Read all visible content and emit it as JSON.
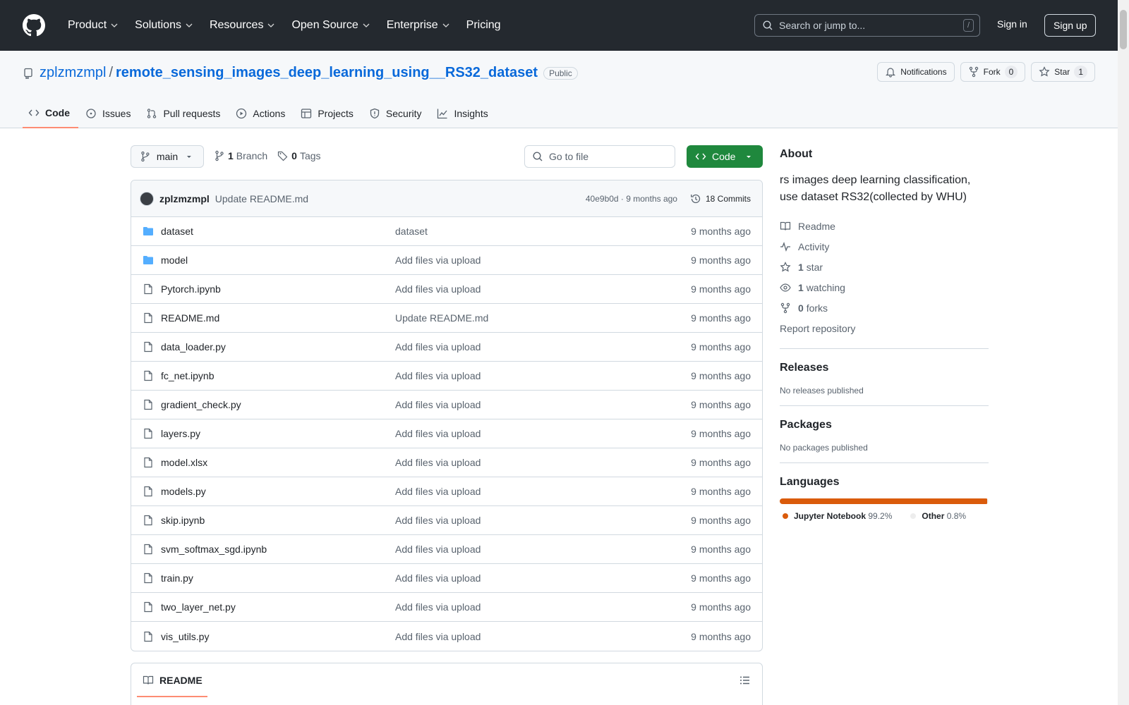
{
  "header": {
    "nav": [
      "Product",
      "Solutions",
      "Resources",
      "Open Source",
      "Enterprise",
      "Pricing"
    ],
    "search_placeholder": "Search or jump to...",
    "search_shortcut": "/",
    "signin": "Sign in",
    "signup": "Sign up"
  },
  "repo": {
    "owner": "zplzmzmpl",
    "separator": "/",
    "name": "remote_sensing_images_deep_learning_using__RS32_dataset",
    "visibility": "Public",
    "notifications_label": "Notifications",
    "fork_label": "Fork",
    "fork_count": "0",
    "star_label": "Star",
    "star_count": "1"
  },
  "tabs": [
    "Code",
    "Issues",
    "Pull requests",
    "Actions",
    "Projects",
    "Security",
    "Insights"
  ],
  "branch": {
    "name": "main",
    "branch_count": "1",
    "branch_label": "Branch",
    "tag_count": "0",
    "tag_label": "Tags",
    "goto_placeholder": "Go to file",
    "code_button": "Code"
  },
  "latest_commit": {
    "author": "zplzmzmpl",
    "message": "Update README.md",
    "hash_time": "40e9b0d · 9 months ago",
    "commits_label": "18 Commits"
  },
  "files": [
    {
      "name": "dataset",
      "type": "folder",
      "commit": "dataset",
      "time": "9 months ago"
    },
    {
      "name": "model",
      "type": "folder",
      "commit": "Add files via upload",
      "time": "9 months ago"
    },
    {
      "name": "Pytorch.ipynb",
      "type": "file",
      "commit": "Add files via upload",
      "time": "9 months ago"
    },
    {
      "name": "README.md",
      "type": "file",
      "commit": "Update README.md",
      "time": "9 months ago"
    },
    {
      "name": "data_loader.py",
      "type": "file",
      "commit": "Add files via upload",
      "time": "9 months ago"
    },
    {
      "name": "fc_net.ipynb",
      "type": "file",
      "commit": "Add files via upload",
      "time": "9 months ago"
    },
    {
      "name": "gradient_check.py",
      "type": "file",
      "commit": "Add files via upload",
      "time": "9 months ago"
    },
    {
      "name": "layers.py",
      "type": "file",
      "commit": "Add files via upload",
      "time": "9 months ago"
    },
    {
      "name": "model.xlsx",
      "type": "file",
      "commit": "Add files via upload",
      "time": "9 months ago"
    },
    {
      "name": "models.py",
      "type": "file",
      "commit": "Add files via upload",
      "time": "9 months ago"
    },
    {
      "name": "skip.ipynb",
      "type": "file",
      "commit": "Add files via upload",
      "time": "9 months ago"
    },
    {
      "name": "svm_softmax_sgd.ipynb",
      "type": "file",
      "commit": "Add files via upload",
      "time": "9 months ago"
    },
    {
      "name": "train.py",
      "type": "file",
      "commit": "Add files via upload",
      "time": "9 months ago"
    },
    {
      "name": "two_layer_net.py",
      "type": "file",
      "commit": "Add files via upload",
      "time": "9 months ago"
    },
    {
      "name": "vis_utils.py",
      "type": "file",
      "commit": "Add files via upload",
      "time": "9 months ago"
    }
  ],
  "readme": {
    "title": "README"
  },
  "about": {
    "title": "About",
    "description": "rs images deep learning classification, use dataset RS32(collected by WHU)",
    "readme": "Readme",
    "activity": "Activity",
    "stars_count": "1",
    "stars_label": "star",
    "watching_count": "1",
    "watching_label": "watching",
    "forks_count": "0",
    "forks_label": "forks",
    "report": "Report repository"
  },
  "releases": {
    "title": "Releases",
    "text": "No releases published"
  },
  "packages": {
    "title": "Packages",
    "text": "No packages published"
  },
  "languages": {
    "title": "Languages",
    "items": [
      {
        "name": "Jupyter Notebook",
        "percent": "99.2%",
        "value": 99.2,
        "color": "#DA5B0B"
      },
      {
        "name": "Other",
        "percent": "0.8%",
        "value": 0.8,
        "color": "#ededed"
      }
    ]
  }
}
